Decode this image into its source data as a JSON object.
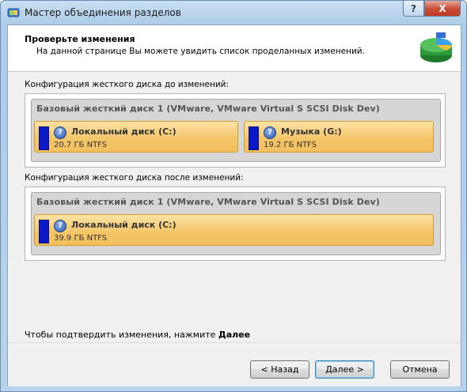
{
  "window": {
    "title": "Мастер объединения разделов",
    "help_label": "?",
    "close_label": "X"
  },
  "header": {
    "title": "Проверьте изменения",
    "subtitle": "На данной странице Вы можете увидить список проделанных изменений."
  },
  "before": {
    "label": "Конфигурация жесткого диска до изменений:",
    "disk_title": "Базовый жесткий диск 1 (VMware, VMware Virtual S SCSI Disk Dev)",
    "partitions": [
      {
        "name": "Локальный диск (C:)",
        "size": "20.7 ГБ NTFS",
        "icon": "question-icon"
      },
      {
        "name": "Музыка (G:)",
        "size": "19.2 ГБ NTFS",
        "icon": "question-icon"
      }
    ]
  },
  "after": {
    "label": "Конфигурация жесткого диска после изменений:",
    "disk_title": "Базовый жесткий диск 1 (VMware, VMware Virtual S SCSI Disk Dev)",
    "partitions": [
      {
        "name": "Локальный диск (C:)",
        "size": "39.9 ГБ NTFS",
        "icon": "question-icon"
      }
    ]
  },
  "footer": {
    "prompt_text": "Чтобы подтвердить изменения, нажмите ",
    "prompt_bold": "Далее"
  },
  "buttons": {
    "back": "< Назад",
    "next": "Далее >",
    "cancel": "Отмена"
  },
  "colors": {
    "partition_fill": "#0a18c7",
    "partition_bg": "#f4c466",
    "disk_bar_bg": "#d6d6d6"
  }
}
